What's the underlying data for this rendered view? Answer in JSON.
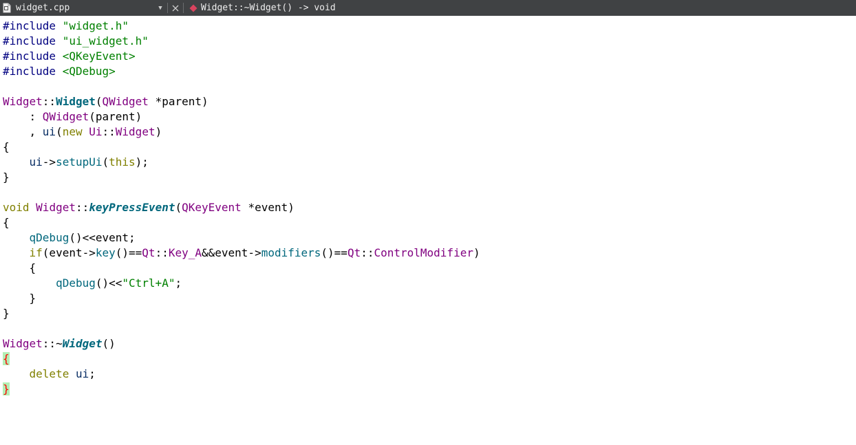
{
  "toolbar": {
    "file_name": "widget.cpp",
    "symbol_label": "Widget::~Widget() -> void",
    "dropdown_icon": "triangle-down",
    "close_icon": "x",
    "file_icon": "document-icon",
    "symbol_icon": "function-diamond-icon"
  },
  "colors": {
    "toolbar_bg": "#404244",
    "keyword": "#808000",
    "type": "#800080",
    "function_decl": "#00677c",
    "string": "#008000",
    "brace_match_bg": "#b4eeb4"
  },
  "code": {
    "lines": [
      [
        {
          "c": "tk-pre",
          "t": "#include"
        },
        {
          "c": "tk-plain",
          "t": " "
        },
        {
          "c": "tk-str",
          "t": "\"widget.h\""
        }
      ],
      [
        {
          "c": "tk-pre",
          "t": "#include"
        },
        {
          "c": "tk-plain",
          "t": " "
        },
        {
          "c": "tk-str",
          "t": "\"ui_widget.h\""
        }
      ],
      [
        {
          "c": "tk-pre",
          "t": "#include"
        },
        {
          "c": "tk-plain",
          "t": " "
        },
        {
          "c": "tk-str",
          "t": "<QKeyEvent>"
        }
      ],
      [
        {
          "c": "tk-pre",
          "t": "#include"
        },
        {
          "c": "tk-plain",
          "t": " "
        },
        {
          "c": "tk-str",
          "t": "<QDebug>"
        }
      ],
      [],
      [
        {
          "c": "tk-type",
          "t": "Widget"
        },
        {
          "c": "tk-plain",
          "t": "::"
        },
        {
          "c": "tk-fn-decl",
          "t": "Widget"
        },
        {
          "c": "tk-plain",
          "t": "("
        },
        {
          "c": "tk-type",
          "t": "QWidget"
        },
        {
          "c": "tk-plain",
          "t": " *parent)"
        }
      ],
      [
        {
          "c": "tk-plain",
          "t": "    : "
        },
        {
          "c": "tk-type",
          "t": "QWidget"
        },
        {
          "c": "tk-plain",
          "t": "(parent)"
        }
      ],
      [
        {
          "c": "tk-plain",
          "t": "    , "
        },
        {
          "c": "tk-param",
          "t": "ui"
        },
        {
          "c": "tk-plain",
          "t": "("
        },
        {
          "c": "tk-kw",
          "t": "new"
        },
        {
          "c": "tk-plain",
          "t": " "
        },
        {
          "c": "tk-type",
          "t": "Ui"
        },
        {
          "c": "tk-plain",
          "t": "::"
        },
        {
          "c": "tk-type",
          "t": "Widget"
        },
        {
          "c": "tk-plain",
          "t": ")"
        }
      ],
      [
        {
          "c": "tk-plain",
          "t": "{"
        }
      ],
      [
        {
          "c": "tk-plain",
          "t": "    "
        },
        {
          "c": "tk-param",
          "t": "ui"
        },
        {
          "c": "tk-plain",
          "t": "->"
        },
        {
          "c": "tk-call",
          "t": "setupUi"
        },
        {
          "c": "tk-plain",
          "t": "("
        },
        {
          "c": "tk-kw",
          "t": "this"
        },
        {
          "c": "tk-plain",
          "t": ");"
        }
      ],
      [
        {
          "c": "tk-plain",
          "t": "}"
        }
      ],
      [],
      [
        {
          "c": "tk-kw",
          "t": "void"
        },
        {
          "c": "tk-plain",
          "t": " "
        },
        {
          "c": "tk-type",
          "t": "Widget"
        },
        {
          "c": "tk-plain",
          "t": "::"
        },
        {
          "c": "tk-fn-italic",
          "t": "keyPressEvent"
        },
        {
          "c": "tk-plain",
          "t": "("
        },
        {
          "c": "tk-type",
          "t": "QKeyEvent"
        },
        {
          "c": "tk-plain",
          "t": " *event)"
        }
      ],
      [
        {
          "c": "tk-plain",
          "t": "{"
        }
      ],
      [
        {
          "c": "tk-plain",
          "t": "    "
        },
        {
          "c": "tk-call",
          "t": "qDebug"
        },
        {
          "c": "tk-plain",
          "t": "()<<event;"
        }
      ],
      [
        {
          "c": "tk-plain",
          "t": "    "
        },
        {
          "c": "tk-kw",
          "t": "if"
        },
        {
          "c": "tk-plain",
          "t": "(event->"
        },
        {
          "c": "tk-call",
          "t": "key"
        },
        {
          "c": "tk-plain",
          "t": "()=="
        },
        {
          "c": "tk-type",
          "t": "Qt"
        },
        {
          "c": "tk-plain",
          "t": "::"
        },
        {
          "c": "tk-type",
          "t": "Key_A"
        },
        {
          "c": "tk-plain",
          "t": "&&event->"
        },
        {
          "c": "tk-call",
          "t": "modifiers"
        },
        {
          "c": "tk-plain",
          "t": "()=="
        },
        {
          "c": "tk-type",
          "t": "Qt"
        },
        {
          "c": "tk-plain",
          "t": "::"
        },
        {
          "c": "tk-type",
          "t": "ControlModifier"
        },
        {
          "c": "tk-plain",
          "t": ")"
        }
      ],
      [
        {
          "c": "tk-plain",
          "t": "    {"
        }
      ],
      [
        {
          "c": "tk-plain",
          "t": "        "
        },
        {
          "c": "tk-call",
          "t": "qDebug"
        },
        {
          "c": "tk-plain",
          "t": "()<<"
        },
        {
          "c": "tk-str",
          "t": "\"Ctrl+A\""
        },
        {
          "c": "tk-plain",
          "t": ";"
        }
      ],
      [
        {
          "c": "tk-plain",
          "t": "    }"
        }
      ],
      [
        {
          "c": "tk-plain",
          "t": "}"
        }
      ],
      [],
      [
        {
          "c": "tk-type",
          "t": "Widget"
        },
        {
          "c": "tk-plain",
          "t": "::~"
        },
        {
          "c": "tk-fn-italic",
          "t": "Widget"
        },
        {
          "c": "tk-plain",
          "t": "()"
        }
      ],
      [
        {
          "c": "brace-match",
          "t": "{"
        }
      ],
      [
        {
          "c": "tk-plain",
          "t": "    "
        },
        {
          "c": "tk-kw",
          "t": "delete"
        },
        {
          "c": "tk-plain",
          "t": " "
        },
        {
          "c": "tk-param",
          "t": "ui"
        },
        {
          "c": "tk-plain",
          "t": ";"
        }
      ],
      [
        {
          "c": "brace-match",
          "t": "}"
        }
      ]
    ]
  }
}
